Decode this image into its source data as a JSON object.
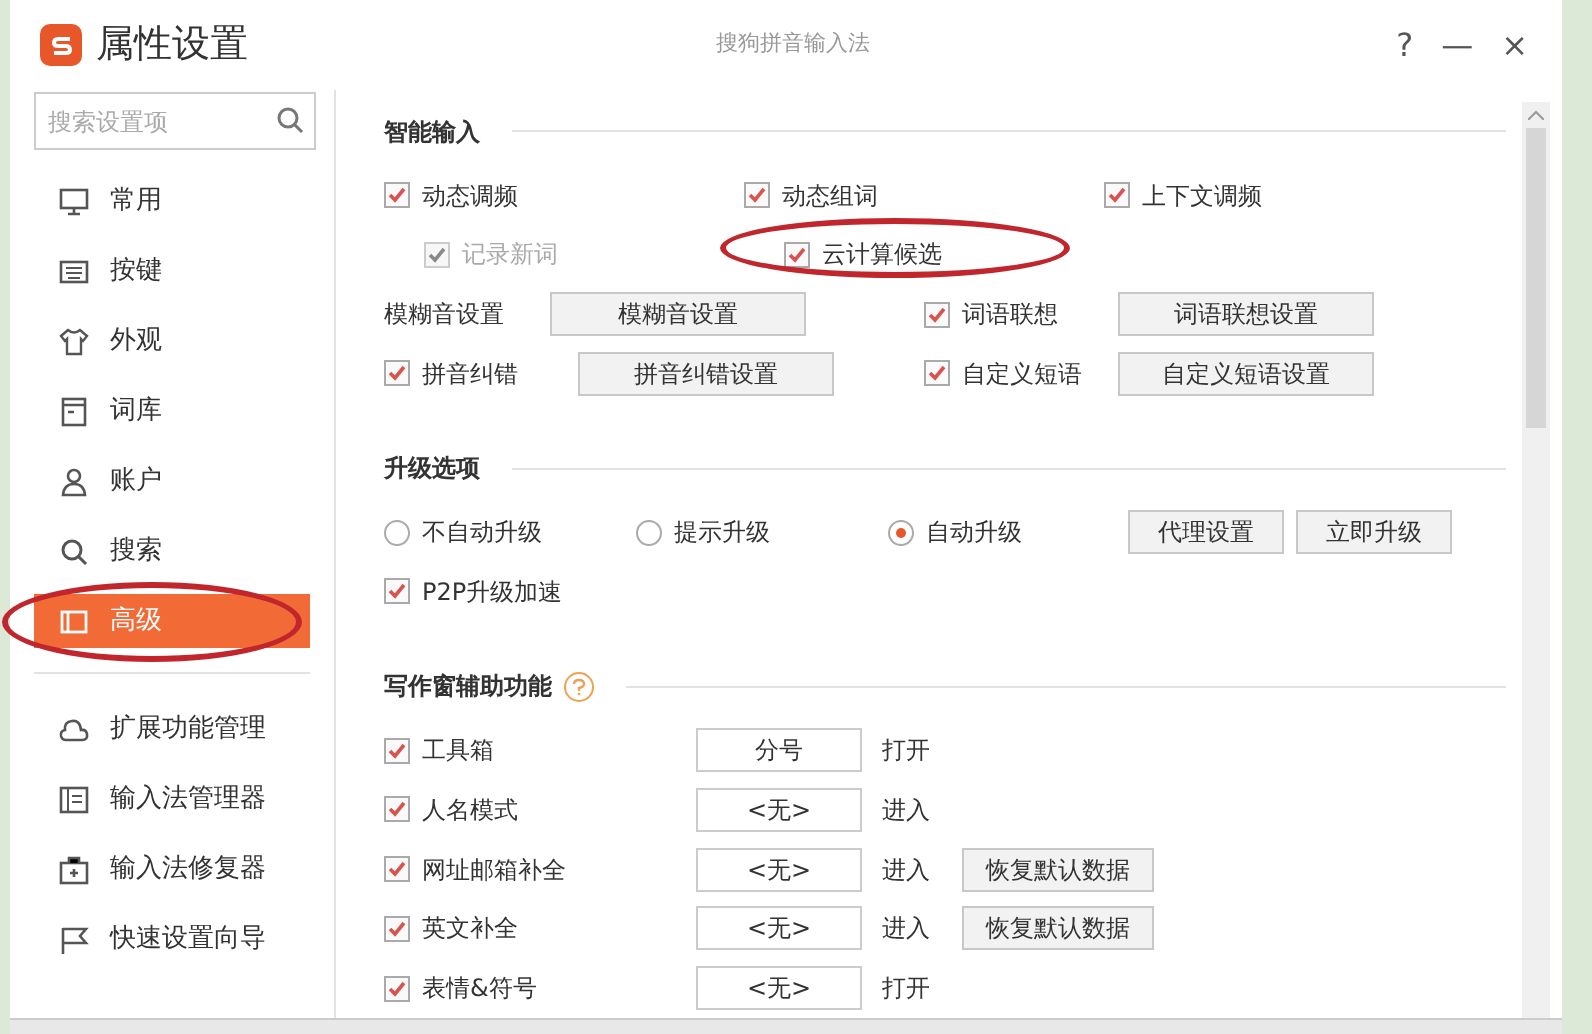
{
  "window": {
    "title": "属性设置",
    "app_name": "搜狗拼音输入法",
    "controls": [
      "?",
      "—",
      "×"
    ]
  },
  "sidebar": {
    "search": {
      "placeholder": "搜索设置项"
    },
    "items": [
      {
        "label": "常用",
        "selected": false,
        "circled": false
      },
      {
        "label": "按键",
        "selected": false,
        "circled": false
      },
      {
        "label": "外观",
        "selected": false,
        "circled": false
      },
      {
        "label": "词库",
        "selected": false,
        "circled": false
      },
      {
        "label": "账户",
        "selected": false,
        "circled": false
      },
      {
        "label": "搜索",
        "selected": false,
        "circled": false
      },
      {
        "label": "高级",
        "selected": true,
        "circled": true
      }
    ],
    "tools": [
      {
        "label": "扩展功能管理"
      },
      {
        "label": "输入法管理器"
      },
      {
        "label": "输入法修复器"
      },
      {
        "label": "快速设置向导"
      }
    ]
  },
  "sections": [
    {
      "title": "智能输入",
      "help": false,
      "rows": [
        {
          "kind": "checks",
          "indent": false,
          "items": [
            {
              "label": "动态调频",
              "checked": true,
              "disabled": false,
              "circled": false
            },
            {
              "label": "动态组词",
              "checked": true,
              "disabled": false,
              "circled": false
            },
            {
              "label": "上下文调频",
              "checked": true,
              "disabled": false,
              "circled": false
            }
          ]
        },
        {
          "kind": "checks",
          "indent": true,
          "items": [
            {
              "label": "记录新词",
              "checked": true,
              "disabled": true,
              "circled": false
            },
            {
              "label": "云计算候选",
              "checked": true,
              "disabled": false,
              "circled": true
            }
          ]
        },
        {
          "kind": "pair",
          "items": [
            {
              "label": "模糊音设置",
              "has_checkbox": false,
              "button": "模糊音设置"
            },
            {
              "label": "词语联想",
              "has_checkbox": true,
              "checked": true,
              "button": "词语联想设置"
            }
          ]
        },
        {
          "kind": "pair",
          "items": [
            {
              "label": "拼音纠错",
              "has_checkbox": true,
              "checked": true,
              "button": "拼音纠错设置"
            },
            {
              "label": "自定义短语",
              "has_checkbox": true,
              "checked": true,
              "button": "自定义短语设置"
            }
          ]
        }
      ]
    },
    {
      "title": "升级选项",
      "help": false,
      "rows": [
        {
          "kind": "radios",
          "items": [
            {
              "label": "不自动升级",
              "selected": false
            },
            {
              "label": "提示升级",
              "selected": false
            },
            {
              "label": "自动升级",
              "selected": true
            }
          ],
          "buttons": [
            "代理设置",
            "立即升级"
          ]
        },
        {
          "kind": "checks",
          "indent": false,
          "items": [
            {
              "label": "P2P升级加速",
              "checked": true,
              "disabled": false,
              "circled": false
            }
          ]
        }
      ]
    },
    {
      "title": "写作窗辅助功能",
      "help": true,
      "rows": [
        {
          "kind": "hotkey",
          "label": "工具箱",
          "checked": true,
          "value": "分号",
          "action": "打开"
        },
        {
          "kind": "hotkey",
          "label": "人名模式",
          "checked": true,
          "value": "<无>",
          "action": "进入"
        },
        {
          "kind": "hotkey",
          "label": "网址邮箱补全",
          "checked": true,
          "value": "<无>",
          "action": "进入",
          "button": "恢复默认数据"
        },
        {
          "kind": "hotkey",
          "label": "英文补全",
          "checked": true,
          "value": "<无>",
          "action": "进入",
          "button": "恢复默认数据"
        },
        {
          "kind": "hotkey",
          "label": "表情&符号",
          "checked": true,
          "value": "<无>",
          "action": "打开"
        }
      ]
    }
  ]
}
